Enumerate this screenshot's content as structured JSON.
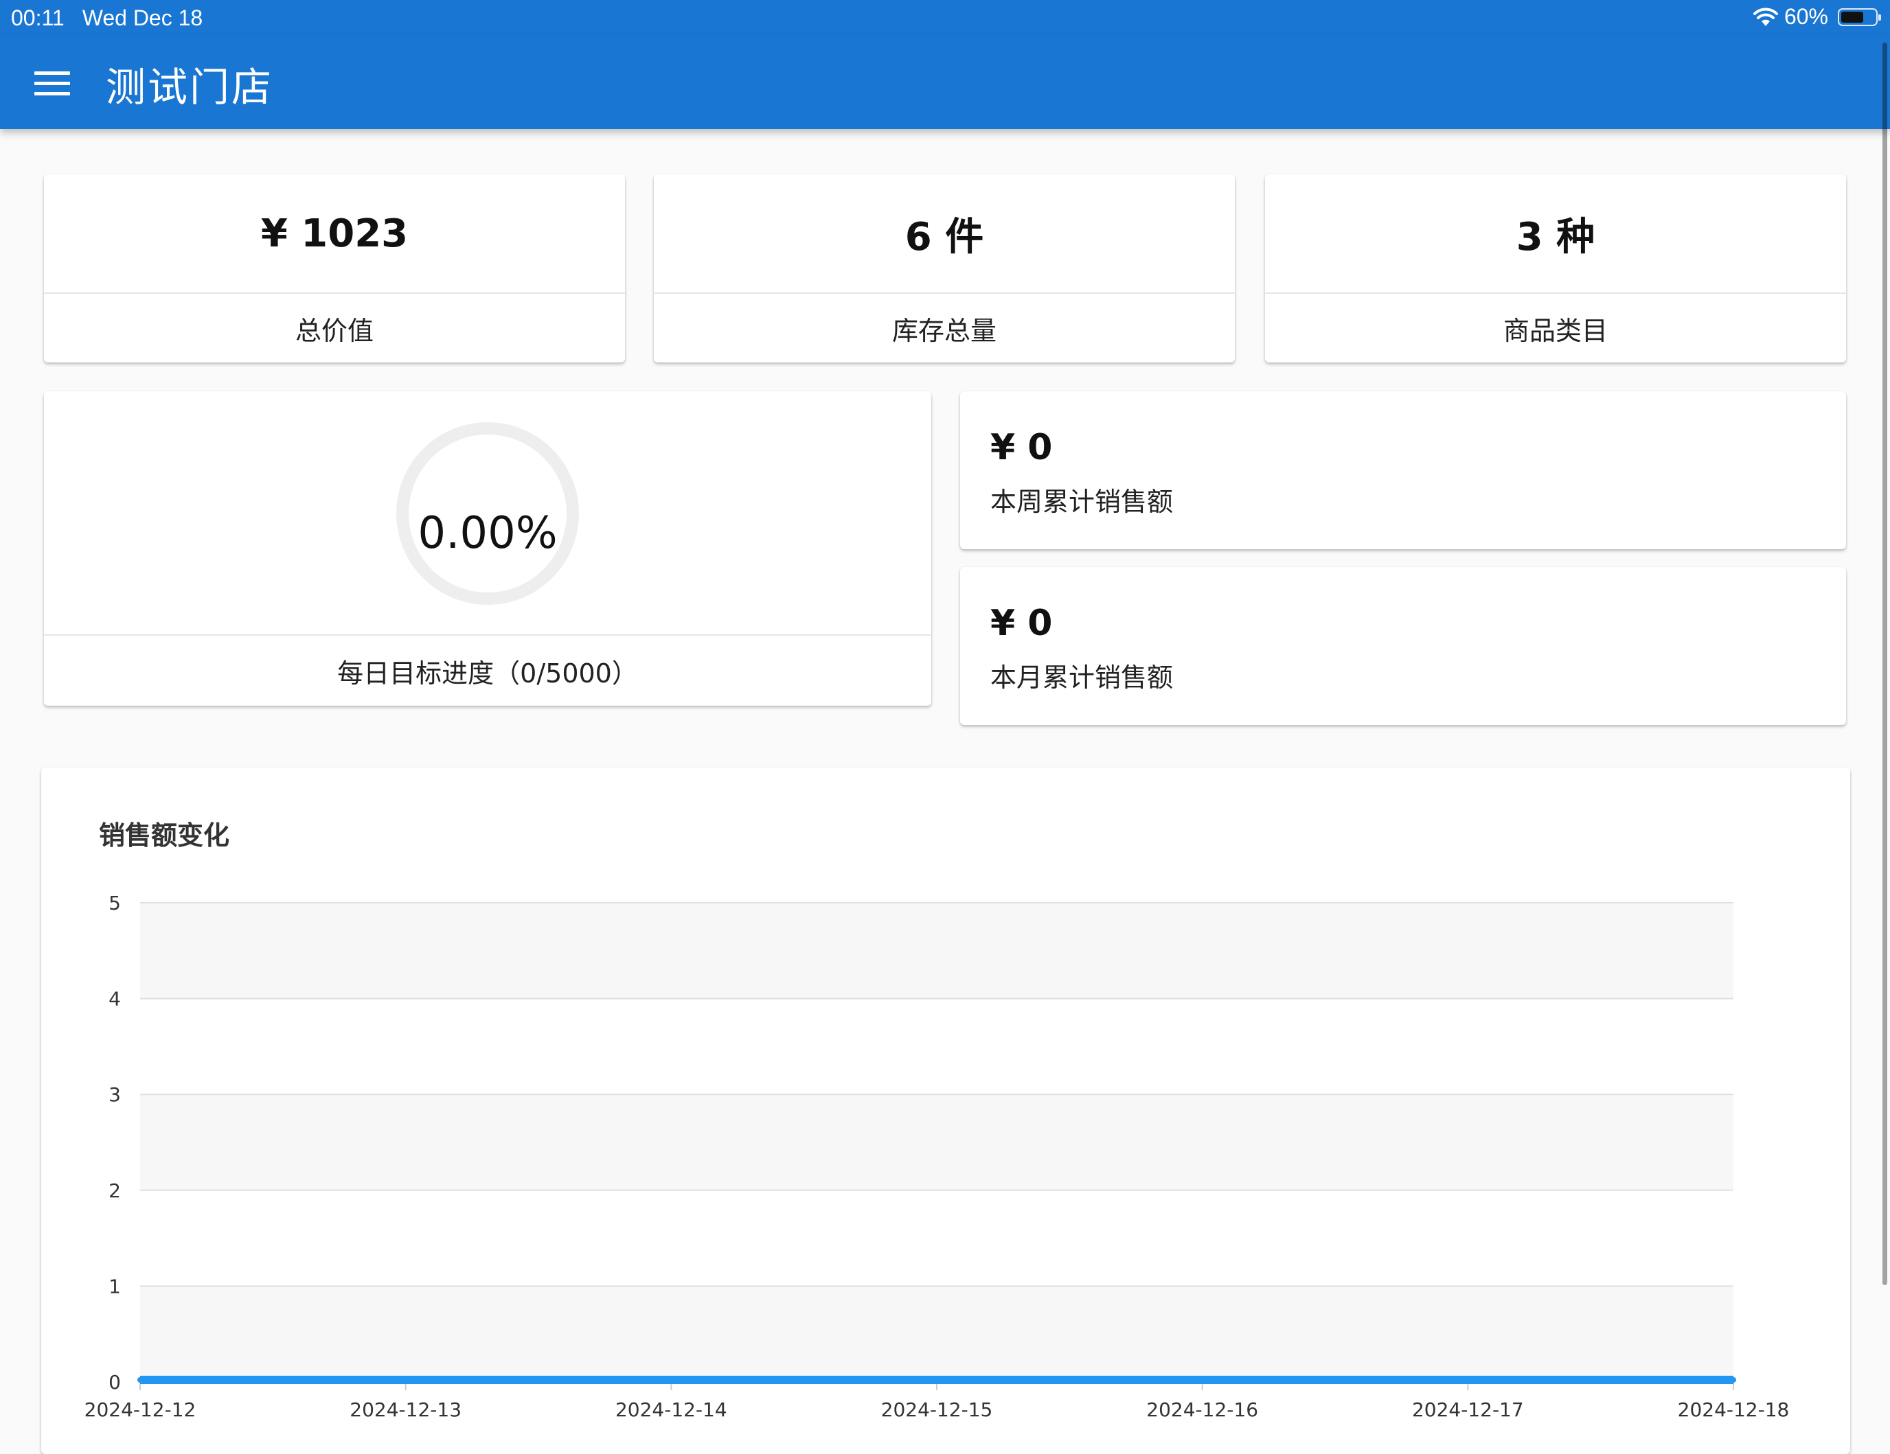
{
  "status_bar": {
    "time": "00:11",
    "date": "Wed Dec 18",
    "battery": "60%",
    "wifi_icon": "wifi-icon",
    "battery_icon": "battery-icon"
  },
  "app_bar": {
    "title": "测试门店",
    "menu_icon": "menu-icon"
  },
  "stats": [
    {
      "value": "¥ 1023",
      "label": "总价值"
    },
    {
      "value": "6 件",
      "label": "库存总量"
    },
    {
      "value": "3 种",
      "label": "商品类目"
    }
  ],
  "daily_goal": {
    "percent_text": "0.00%",
    "progress": 0.0,
    "label": "每日目标进度（0/5000）"
  },
  "sales": {
    "week": {
      "amount": "¥ 0",
      "label": "本周累计销售额"
    },
    "month": {
      "amount": "¥ 0",
      "label": "本月累计销售额"
    }
  },
  "chart_data": {
    "type": "line",
    "title": "销售额变化",
    "x": [
      "2024-12-12",
      "2024-12-13",
      "2024-12-14",
      "2024-12-15",
      "2024-12-16",
      "2024-12-17",
      "2024-12-18"
    ],
    "series": [
      {
        "values": [
          0,
          0,
          0,
          0,
          0,
          0,
          0
        ]
      }
    ],
    "ylim": [
      0,
      5
    ],
    "y_ticks": [
      0,
      1,
      2,
      3,
      4,
      5
    ],
    "grid": true,
    "series_color": "#2196f3"
  }
}
